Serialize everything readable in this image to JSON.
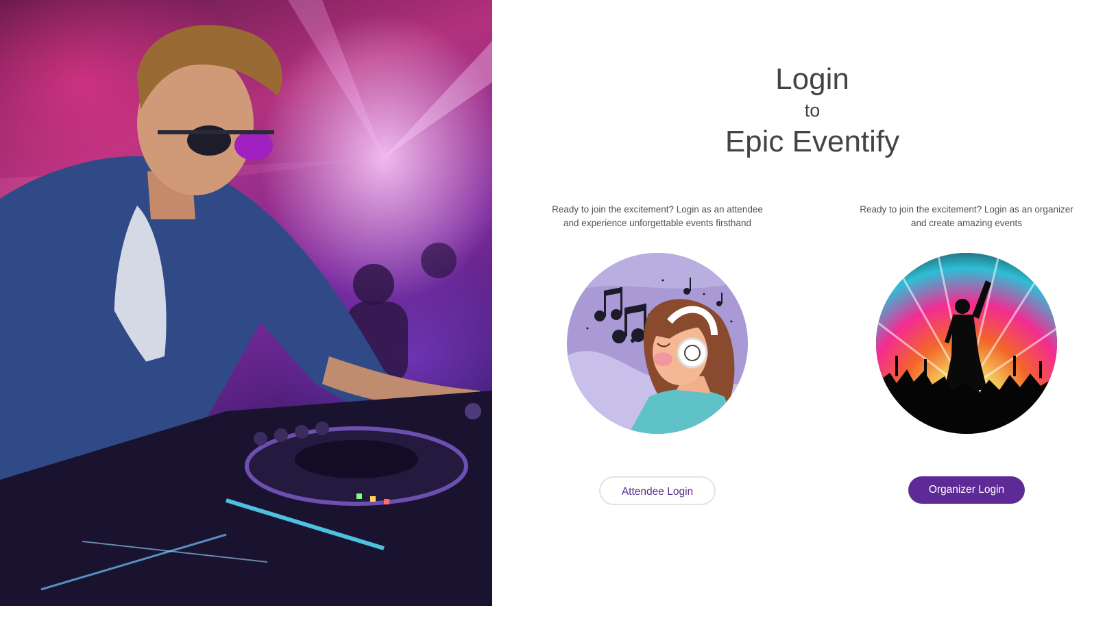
{
  "hero": {
    "image_subject": "dj-mixing-at-nightclub"
  },
  "heading": {
    "line1": "Login",
    "line2": "to",
    "line3": "Epic Eventify"
  },
  "attendee": {
    "description": "Ready to join the excitement? Login as an attendee and experience unforgettable events firsthand",
    "button_label": "Attendee Login"
  },
  "organizer": {
    "description": "Ready to join the excitement? Login as an organizer and create amazing events",
    "button_label": "Organizer Login"
  },
  "colors": {
    "accent": "#5e2a96",
    "heading_text": "#444444"
  }
}
